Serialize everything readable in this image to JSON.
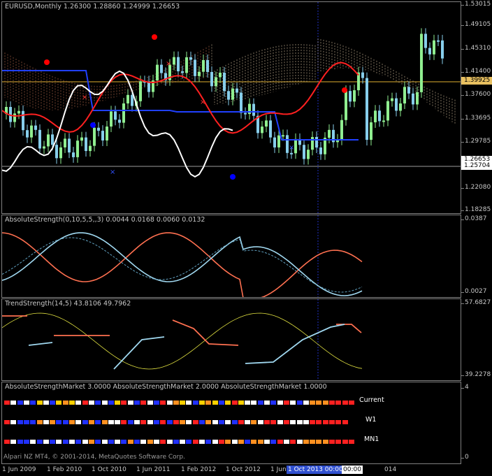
{
  "main": {
    "title": "EURUSD,Monthly  1.26300 1.28860 1.24999 1.26653",
    "axis_ticks": [
      "1.53015",
      "1.49105",
      "1.45310",
      "1.41400",
      "1.37600",
      "1.33695",
      "1.29785",
      "1.25985",
      "1.22080",
      "1.18285"
    ],
    "labels": {
      "gold_line": "1.39925",
      "current": "1.26653",
      "white_line": "1.25704"
    },
    "colors": {
      "bull": "#90ee90",
      "bear": "#87ceeb",
      "gold_line": "#e0b030",
      "tenkan": "#ff2020",
      "kijun": "#2040ff",
      "chikou": "#ffffff"
    }
  },
  "abs_strength": {
    "title": "AbsoluteStrength(0,10,5,5,,3) 0.0044 0.0168 0.0060 0.0132",
    "axis_ticks": [
      "0.0387",
      "0.0027"
    ]
  },
  "trend_strength": {
    "title": "TrendStrength(14,5) 43.8106 49.7962",
    "axis_ticks": [
      "57.6827",
      "39.2278"
    ]
  },
  "asm": {
    "title": "AbsoluteStrengthMarket 3.0000  AbsoluteStrengthMarket 2.0000  AbsoluteStrengthMarket 1.0000",
    "axis_ticks": [
      "4",
      "0"
    ],
    "rows": [
      {
        "label": "Current",
        "pattern": "rwbwbywbyoywrwbwbyrwbrwbrwoywbyoybyrywwbwbwrwbwooorrrr"
      },
      {
        "label": "W1",
        "pattern": "rwbbbowobbowbobowwrbwrwbrbrowrbowbwbrwowrrwrwwwrrrrrr"
      },
      {
        "label": "MN1",
        "pattern": "rwbbwbwbwbwbwobwbwbobwowrwbwbrwbwrowoboowbrwrwoooorrrr"
      }
    ]
  },
  "time_axis": [
    "1 Jun 2009",
    "1 Feb 2010",
    "1 Oct 2010",
    "1 Jun 2011",
    "1 Feb 2012",
    "1 Oct 2012",
    "1 Jun"
  ],
  "badges": {
    "b1": "1 Oct 2013 00:00",
    "b2": "00:00",
    "b3": "014"
  },
  "footer": "Alpari NZ MT4, © 2001-2014, MetaQuotes Software Corp."
}
